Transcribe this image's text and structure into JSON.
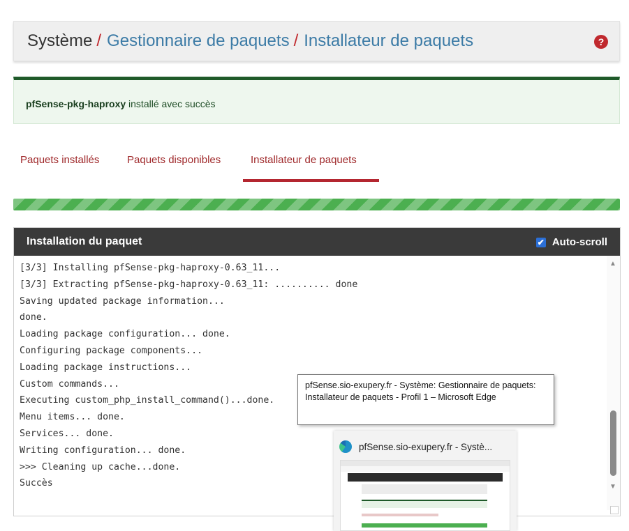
{
  "breadcrumb": {
    "root": "Système",
    "separator": "/",
    "link1": "Gestionnaire de paquets",
    "link2": "Installateur de paquets",
    "help_icon": "question-circle-icon"
  },
  "alert": {
    "package_name": "pfSense-pkg-haproxy",
    "message": "installé avec succès"
  },
  "tabs": [
    {
      "label": "Paquets installés",
      "active": false
    },
    {
      "label": "Paquets disponibles",
      "active": false
    },
    {
      "label": "Installateur de paquets",
      "active": true
    }
  ],
  "progress": {
    "percent": 100,
    "color": "#4caf50"
  },
  "console": {
    "title": "Installation du paquet",
    "autoscroll_label": "Auto-scroll",
    "autoscroll_checked": true,
    "lines": [
      "[3/3] Installing pfSense-pkg-haproxy-0.63_11...",
      "[3/3] Extracting pfSense-pkg-haproxy-0.63_11: .......... done",
      "Saving updated package information...",
      "done.",
      "Loading package configuration... done.",
      "Configuring package components...",
      "Loading package instructions...",
      "Custom commands...",
      "Executing custom_php_install_command()...done.",
      "Menu items... done.",
      "Services... done.",
      "Writing configuration... done.",
      ">>> Cleaning up cache...done.",
      "Succès"
    ]
  },
  "tooltip": {
    "text": "pfSense.sio-exupery.fr - Système: Gestionnaire de paquets: Installateur de paquets - Profil 1 – Microsoft Edge"
  },
  "taskbar_preview": {
    "title": "pfSense.sio-exupery.fr - Systè...",
    "icon": "edge-browser-icon"
  },
  "colors": {
    "accent_red": "#c0292e",
    "link_blue": "#3c7ba6",
    "success_green": "#1f5a2a",
    "header_dark": "#3a3a3a"
  }
}
